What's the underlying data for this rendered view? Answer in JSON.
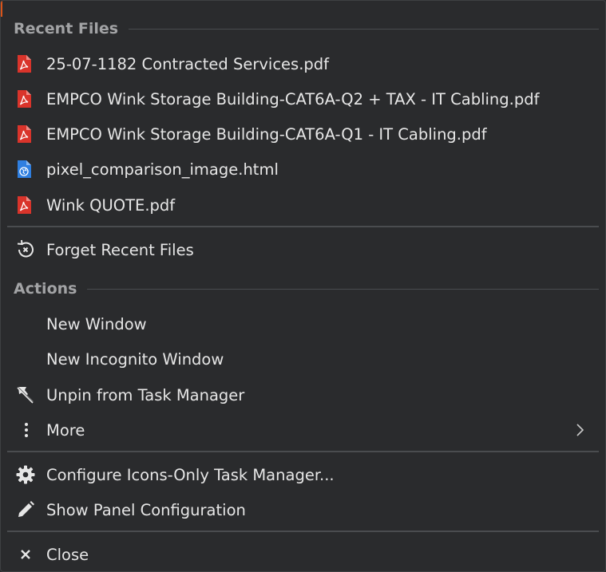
{
  "recent_files": {
    "header": "Recent Files",
    "items": [
      {
        "label": "25-07-1182 Contracted Services.pdf",
        "icon": "pdf-file-icon"
      },
      {
        "label": "EMPCO Wink Storage Building-CAT6A-Q2 + TAX - IT Cabling.pdf",
        "icon": "pdf-file-icon"
      },
      {
        "label": "EMPCO Wink Storage Building-CAT6A-Q1 - IT Cabling.pdf",
        "icon": "pdf-file-icon"
      },
      {
        "label": "pixel_comparison_image.html",
        "icon": "html-file-icon"
      },
      {
        "label": "Wink QUOTE.pdf",
        "icon": "pdf-file-icon"
      }
    ],
    "forget_label": "Forget Recent Files"
  },
  "actions": {
    "header": "Actions",
    "new_window": "New Window",
    "new_incognito": "New Incognito Window",
    "unpin": "Unpin from Task Manager",
    "more": "More"
  },
  "config": {
    "configure": "Configure Icons-Only Task Manager...",
    "show_panel": "Show Panel Configuration"
  },
  "close_label": "Close",
  "colors": {
    "background": "#2a2b2d",
    "text": "#e6e6e6",
    "header_text": "#a2a3a5",
    "pdf_red": "#d9342b",
    "html_blue": "#2f7fe0",
    "accent": "#d9541a"
  }
}
